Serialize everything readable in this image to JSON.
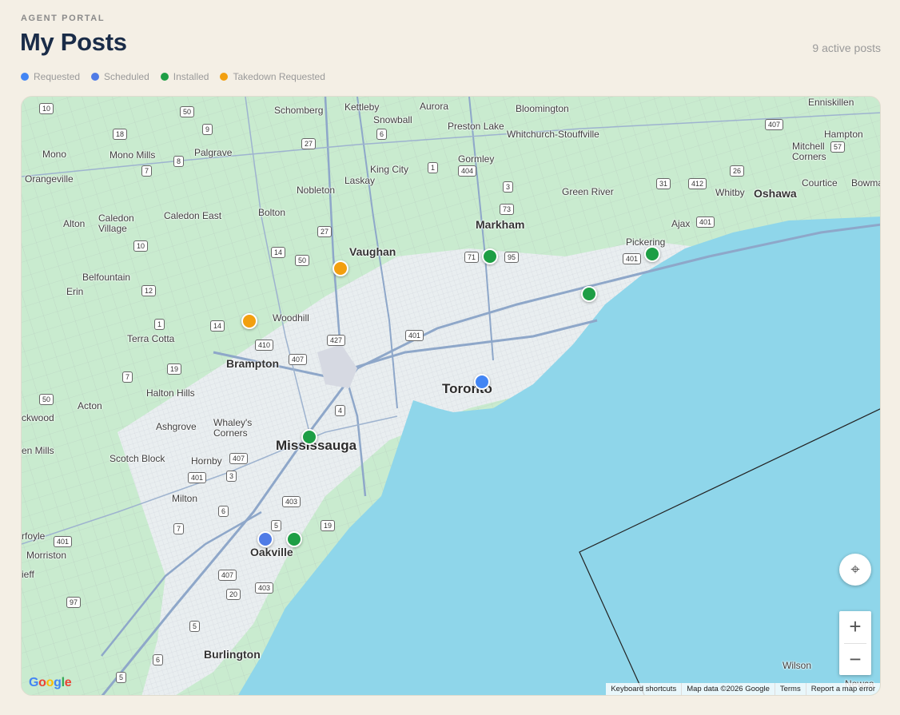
{
  "header": {
    "eyebrow": "AGENT PORTAL",
    "title": "My Posts",
    "count": "9 active posts"
  },
  "legend": [
    {
      "label": "Requested",
      "color": "#4285f4"
    },
    {
      "label": "Scheduled",
      "color": "#4f7be6"
    },
    {
      "label": "Installed",
      "color": "#1e9e45"
    },
    {
      "label": "Takedown Requested",
      "color": "#f29f0f"
    }
  ],
  "map": {
    "cities": {
      "toronto": "Toronto",
      "mississauga": "Mississauga",
      "brampton": "Brampton",
      "vaughan": "Vaughan",
      "markham": "Markham",
      "oakville": "Oakville",
      "burlington": "Burlington",
      "oshawa": "Oshawa",
      "pickering": "Pickering",
      "ajax": "Ajax",
      "whitby": "Whitby",
      "courtice": "Courtice",
      "bowmanville": "Bowma",
      "kettleby": "Kettleby",
      "aurora": "Aurora",
      "bloomington": "Bloomington",
      "schomberg": "Schomberg",
      "snowball": "Snowball",
      "preston_lake": "Preston Lake",
      "whitchurch": "Whitchurch-Stouffville",
      "mono": "Mono",
      "mono_mills": "Mono Mills",
      "palgrave": "Palgrave",
      "gormley": "Gormley",
      "king_city": "King City",
      "laskay": "Laskay",
      "orangeville": "Orangeville",
      "nobleton": "Nobleton",
      "green_river": "Green River",
      "alton": "Alton",
      "caledon_village": "Caledon\nVillage",
      "caledon_east": "Caledon East",
      "bolton": "Bolton",
      "belfountain": "Belfountain",
      "erin": "Erin",
      "woodhill": "Woodhill",
      "terra_cotta": "Terra Cotta",
      "halton_hills": "Halton Hills",
      "acton": "Acton",
      "ashgrove": "Ashgrove",
      "whaleys_corners": "Whaley's\nCorners",
      "scotch_block": "Scotch Block",
      "hornby": "Hornby",
      "milton": "Milton",
      "rockwood": "ckwood",
      "glen_mills": "en Mills",
      "puslinch": "rfoyle",
      "morriston": "Morriston",
      "aberfoyle": "ieff",
      "enniskillen": "Enniskillen",
      "hampton": "Hampton",
      "mitchell_corners": "Mitchell\nCorners",
      "wilson": "Wilson",
      "newcastle": "Newca"
    },
    "shields": [
      "10",
      "50",
      "9",
      "18",
      "7",
      "8",
      "27",
      "6",
      "1",
      "404",
      "3",
      "73",
      "407",
      "31",
      "412",
      "26",
      "57",
      "401",
      "10",
      "14",
      "50",
      "27",
      "71",
      "95",
      "401",
      "12",
      "1",
      "14",
      "410",
      "407",
      "427",
      "401",
      "19",
      "7",
      "50",
      "4",
      "407",
      "401",
      "3",
      "6",
      "403",
      "5",
      "19",
      "401",
      "7",
      "407",
      "20",
      "403",
      "97",
      "5",
      "6",
      "5"
    ],
    "pins": [
      {
        "status": "Takedown Requested",
        "color": "#f29f0f"
      },
      {
        "status": "Takedown Requested",
        "color": "#f29f0f"
      },
      {
        "status": "Installed",
        "color": "#1e9e45"
      },
      {
        "status": "Installed",
        "color": "#1e9e45"
      },
      {
        "status": "Installed",
        "color": "#1e9e45"
      },
      {
        "status": "Requested",
        "color": "#4285f4"
      },
      {
        "status": "Installed",
        "color": "#1e9e45"
      },
      {
        "status": "Scheduled",
        "color": "#4f7be6"
      },
      {
        "status": "Installed",
        "color": "#1e9e45"
      }
    ],
    "controls": {
      "zoom_in": "+",
      "zoom_out": "−",
      "locate": "⌖"
    },
    "google_logo": "Google",
    "attribution": {
      "keyboard": "Keyboard shortcuts",
      "mapdata": "Map data ©2026 Google",
      "terms": "Terms",
      "report": "Report a map error"
    }
  }
}
